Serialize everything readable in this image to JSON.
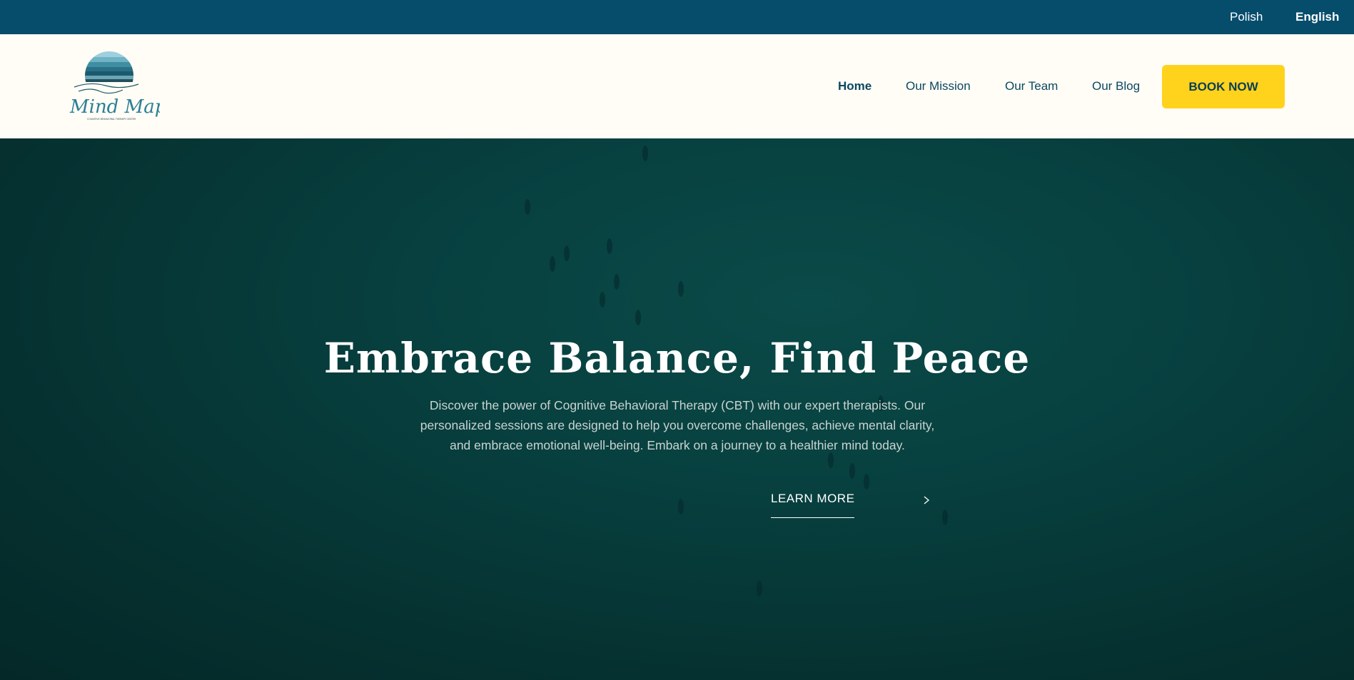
{
  "topbar": {
    "lang_polish": "Polish",
    "lang_english": "English",
    "bg_color": "#064d6c"
  },
  "header": {
    "logo_text": "Mind Map",
    "logo_tagline": "COGNITIVE BEHAVIORAL THERAPY CENTER",
    "nav": {
      "home": "Home",
      "mission": "Our Mission",
      "team": "Our Team",
      "blog": "Our Blog"
    },
    "book_label": "BOOK NOW",
    "book_color": "#ffd21c"
  },
  "hero": {
    "title": "Embrace Balance, Find Peace",
    "description": "Discover the power of Cognitive Behavioral Therapy (CBT) with our expert therapists. Our personalized sessions are designed to help you overcome challenges, achieve mental clarity, and embrace emotional well-being. Embark on a journey to a healthier mind today.",
    "learn_more": "LEARN MORE",
    "arrow_icon": "chevron-right-icon"
  }
}
